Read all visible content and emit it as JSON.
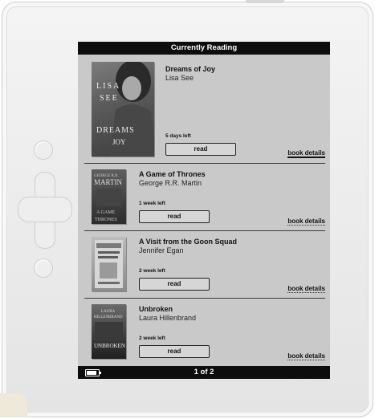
{
  "screen": {
    "header_title": "Currently Reading",
    "pagination": "1 of 2",
    "battery_icon": "battery-icon"
  },
  "books": [
    {
      "title": "Dreams of Joy",
      "author": "Lisa See",
      "time_left": "5 days left",
      "read_label": "read",
      "details_label": "book details",
      "cover_text": [
        "LISA",
        "SEE",
        "DREAMS",
        "JOY"
      ]
    },
    {
      "title": "A Game of Thrones",
      "author": "George R.R. Martin",
      "time_left": "1 week left",
      "read_label": "read",
      "details_label": "book details",
      "cover_text": [
        "GEORGE R.R.",
        "MARTIN",
        "A GAME",
        "THRONES"
      ]
    },
    {
      "title": "A Visit from the Goon Squad",
      "author": "Jennifer Egan",
      "time_left": "2 week left",
      "read_label": "read",
      "details_label": "book details",
      "cover_text": []
    },
    {
      "title": "Unbroken",
      "author": "Laura Hillenbrand",
      "time_left": "2 week left",
      "read_label": "read",
      "details_label": "book details",
      "cover_text": [
        "LAURA",
        "HILLENBRAND",
        "UNBROKEN"
      ]
    }
  ]
}
